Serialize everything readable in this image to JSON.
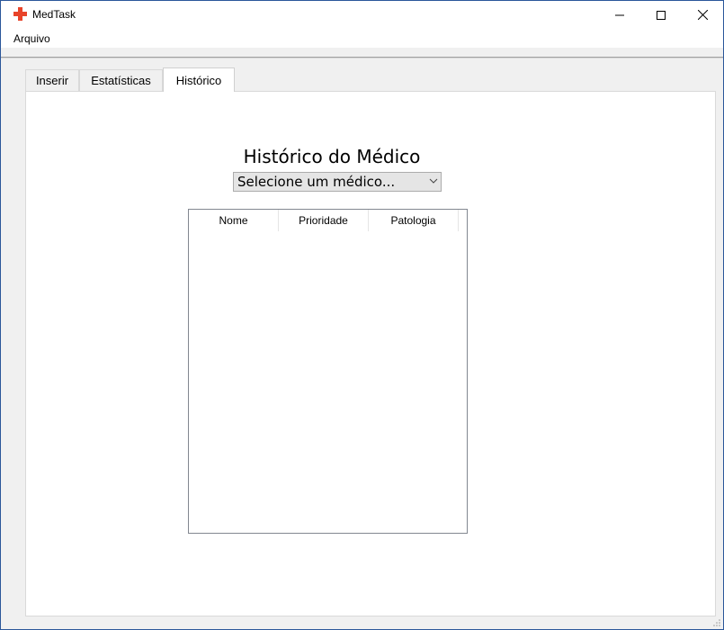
{
  "window": {
    "title": "MedTask",
    "accent": "#e8442a"
  },
  "menubar": {
    "file_label": "Arquivo"
  },
  "tabs": [
    {
      "label": "Inserir",
      "active": false
    },
    {
      "label": "Estatísticas",
      "active": false
    },
    {
      "label": "Histórico",
      "active": true
    }
  ],
  "history": {
    "heading": "Histórico do Médico",
    "doctor_select": {
      "selected": "Selecione um médico..."
    },
    "table": {
      "columns": [
        "Nome",
        "Prioridade",
        "Patologia"
      ],
      "rows": []
    }
  }
}
